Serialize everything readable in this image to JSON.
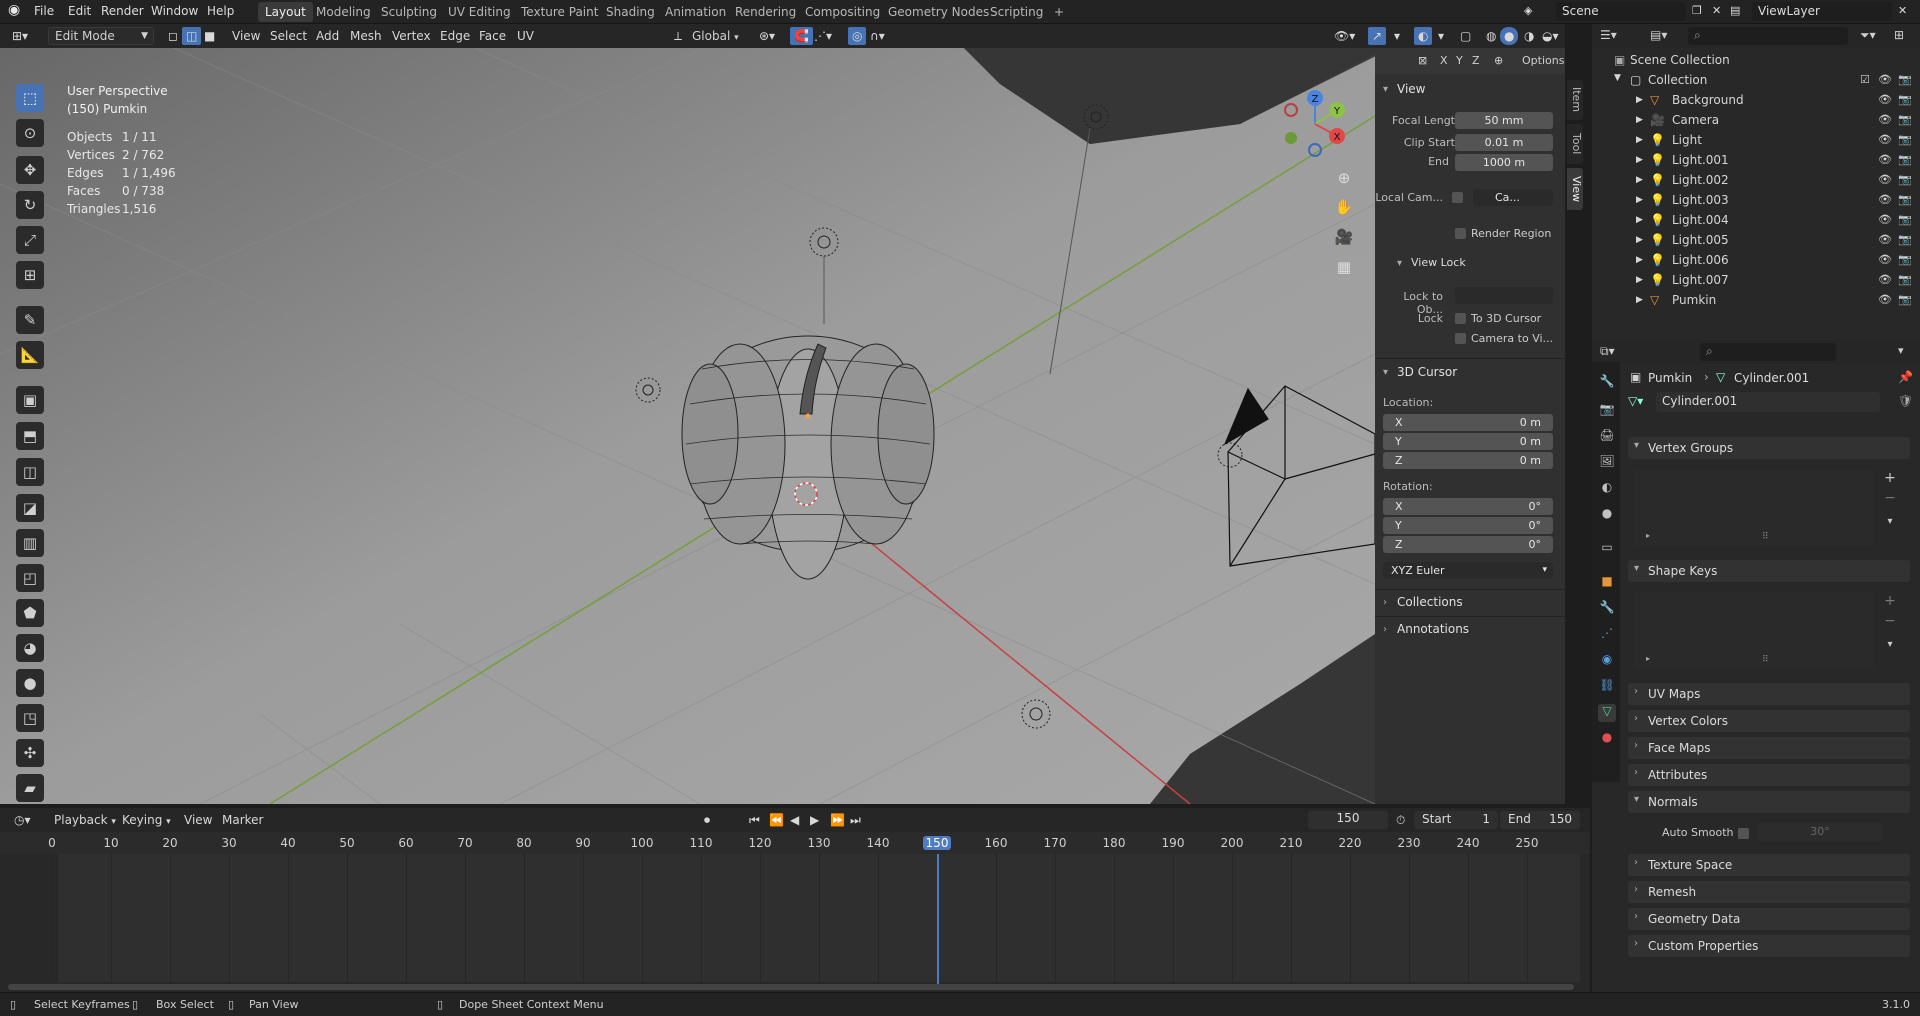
{
  "topbar": {
    "menus": [
      "File",
      "Edit",
      "Render",
      "Window",
      "Help"
    ],
    "workspaces": [
      "Layout",
      "Modeling",
      "Sculpting",
      "UV Editing",
      "Texture Paint",
      "Shading",
      "Animation",
      "Rendering",
      "Compositing",
      "Geometry Nodes",
      "Scripting"
    ],
    "active_workspace": "Layout",
    "add_workspace": "+",
    "scene": "Scene",
    "view_layer": "ViewLayer"
  },
  "viewport_header": {
    "mode": "Edit Mode",
    "menus": [
      "View",
      "Select",
      "Add",
      "Mesh",
      "Vertex",
      "Edge",
      "Face",
      "UV"
    ],
    "orientation": "Global",
    "axes": [
      "X",
      "Y",
      "Z"
    ],
    "options": "Options"
  },
  "overlay": {
    "view_name": "User Perspective",
    "object_name": "(150) Pumkin",
    "stats": [
      {
        "label": "Objects",
        "value": "1 / 11"
      },
      {
        "label": "Vertices",
        "value": "2 / 762"
      },
      {
        "label": "Edges",
        "value": "1 / 1,496"
      },
      {
        "label": "Faces",
        "value": "0 / 738"
      },
      {
        "label": "Triangles",
        "value": "1,516"
      }
    ]
  },
  "gizmo": {
    "x": "X",
    "y": "Y",
    "z": "Z"
  },
  "npanel": {
    "view_section": "View",
    "focal_length_label": "Focal Lengt",
    "focal_length": "50 mm",
    "clip_start_label": "Clip Start",
    "clip_start": "0.01 m",
    "clip_end_label": "End",
    "clip_end": "1000 m",
    "local_camera_label": "Local Cam...",
    "local_camera_value": "Ca...",
    "render_region": "Render Region",
    "view_lock_section": "View Lock",
    "lock_to_object_label": "Lock to Ob...",
    "lock_label": "Lock",
    "to_3d_cursor": "To 3D Cursor",
    "camera_to_view": "Camera to Vi...",
    "cursor_section": "3D Cursor",
    "location_label": "Location:",
    "location": [
      {
        "axis": "X",
        "value": "0 m"
      },
      {
        "axis": "Y",
        "value": "0 m"
      },
      {
        "axis": "Z",
        "value": "0 m"
      }
    ],
    "rotation_label": "Rotation:",
    "rotation": [
      {
        "axis": "X",
        "value": "0°"
      },
      {
        "axis": "Y",
        "value": "0°"
      },
      {
        "axis": "Z",
        "value": "0°"
      }
    ],
    "rotation_mode": "XYZ Euler",
    "collections_section": "Collections",
    "annotations_section": "Annotations",
    "tabs": [
      "Item",
      "Tool",
      "View"
    ]
  },
  "outliner": {
    "root": "Scene Collection",
    "collection": "Collection",
    "items": [
      "Background",
      "Camera",
      "Light",
      "Light.001",
      "Light.002",
      "Light.003",
      "Light.004",
      "Light.005",
      "Light.006",
      "Light.007",
      "Pumkin"
    ]
  },
  "properties": {
    "object": "Pumkin",
    "data": "Cylinder.001",
    "mesh_name": "Cylinder.001",
    "sections": {
      "vertex_groups": "Vertex Groups",
      "shape_keys": "Shape Keys",
      "uv_maps": "UV Maps",
      "vertex_colors": "Vertex Colors",
      "face_maps": "Face Maps",
      "attributes": "Attributes",
      "normals": "Normals",
      "auto_smooth": "Auto Smooth",
      "auto_smooth_angle": "30°",
      "texture_space": "Texture Space",
      "remesh": "Remesh",
      "geometry_data": "Geometry Data",
      "custom_properties": "Custom Properties"
    }
  },
  "timeline": {
    "menus": [
      "Playback",
      "Keying",
      "View",
      "Marker"
    ],
    "current_frame": "150",
    "start_label": "Start",
    "start": "1",
    "end_label": "End",
    "end": "150",
    "ruler": [
      "0",
      "10",
      "20",
      "30",
      "40",
      "50",
      "60",
      "70",
      "80",
      "90",
      "100",
      "110",
      "120",
      "130",
      "140",
      "150",
      "160",
      "170",
      "180",
      "190",
      "200",
      "210",
      "220",
      "230",
      "240",
      "250"
    ]
  },
  "statusbar": {
    "select": "Select Keyframes",
    "box_select": "Box Select",
    "pan": "Pan View",
    "context": "Dope Sheet Context Menu",
    "version": "3.1.0"
  },
  "colors": {
    "accent": "#4772b3",
    "x_axis": "#e04848",
    "y_axis": "#8cc44a",
    "z_axis": "#4a84e0",
    "playhead": "#4d7cc4"
  }
}
